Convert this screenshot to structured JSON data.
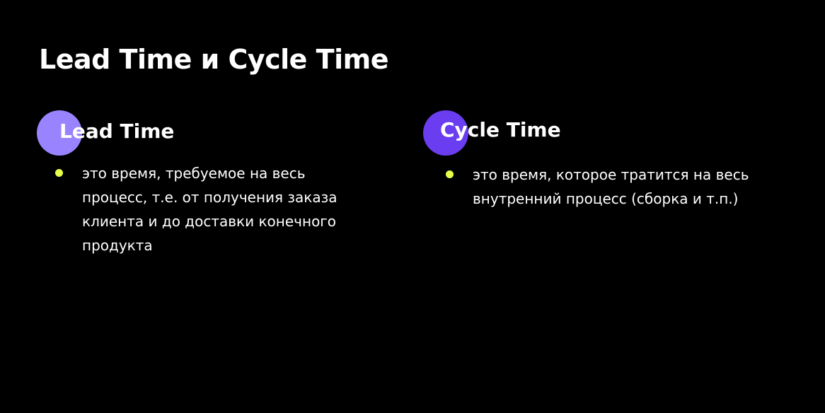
{
  "slide": {
    "title": "Lead Time и Cycle Time"
  },
  "columns": [
    {
      "heading": "Lead Time",
      "accent_color": "#9A83FF",
      "bullets": [
        "это время, требуемое на весь процесс, т.е. от получения заказа клиента и до доставки конечного продукта"
      ]
    },
    {
      "heading": "Cycle Time",
      "accent_color": "#6A3DF0",
      "bullets": [
        "это время, которое тратится на весь внутренний процесс (сборка и т.п.)"
      ]
    }
  ],
  "colors": {
    "background": "#000000",
    "text": "#FFFFFF",
    "bullet": "#E8FF4A"
  }
}
